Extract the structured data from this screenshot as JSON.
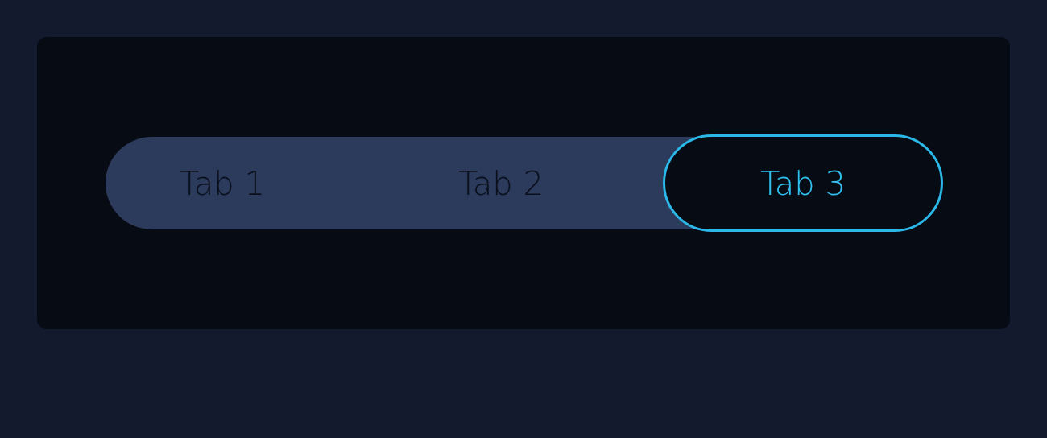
{
  "tabs": [
    {
      "label": "Tab 1",
      "selected": false
    },
    {
      "label": "Tab 2",
      "selected": false
    },
    {
      "label": "Tab 3",
      "selected": true
    }
  ]
}
